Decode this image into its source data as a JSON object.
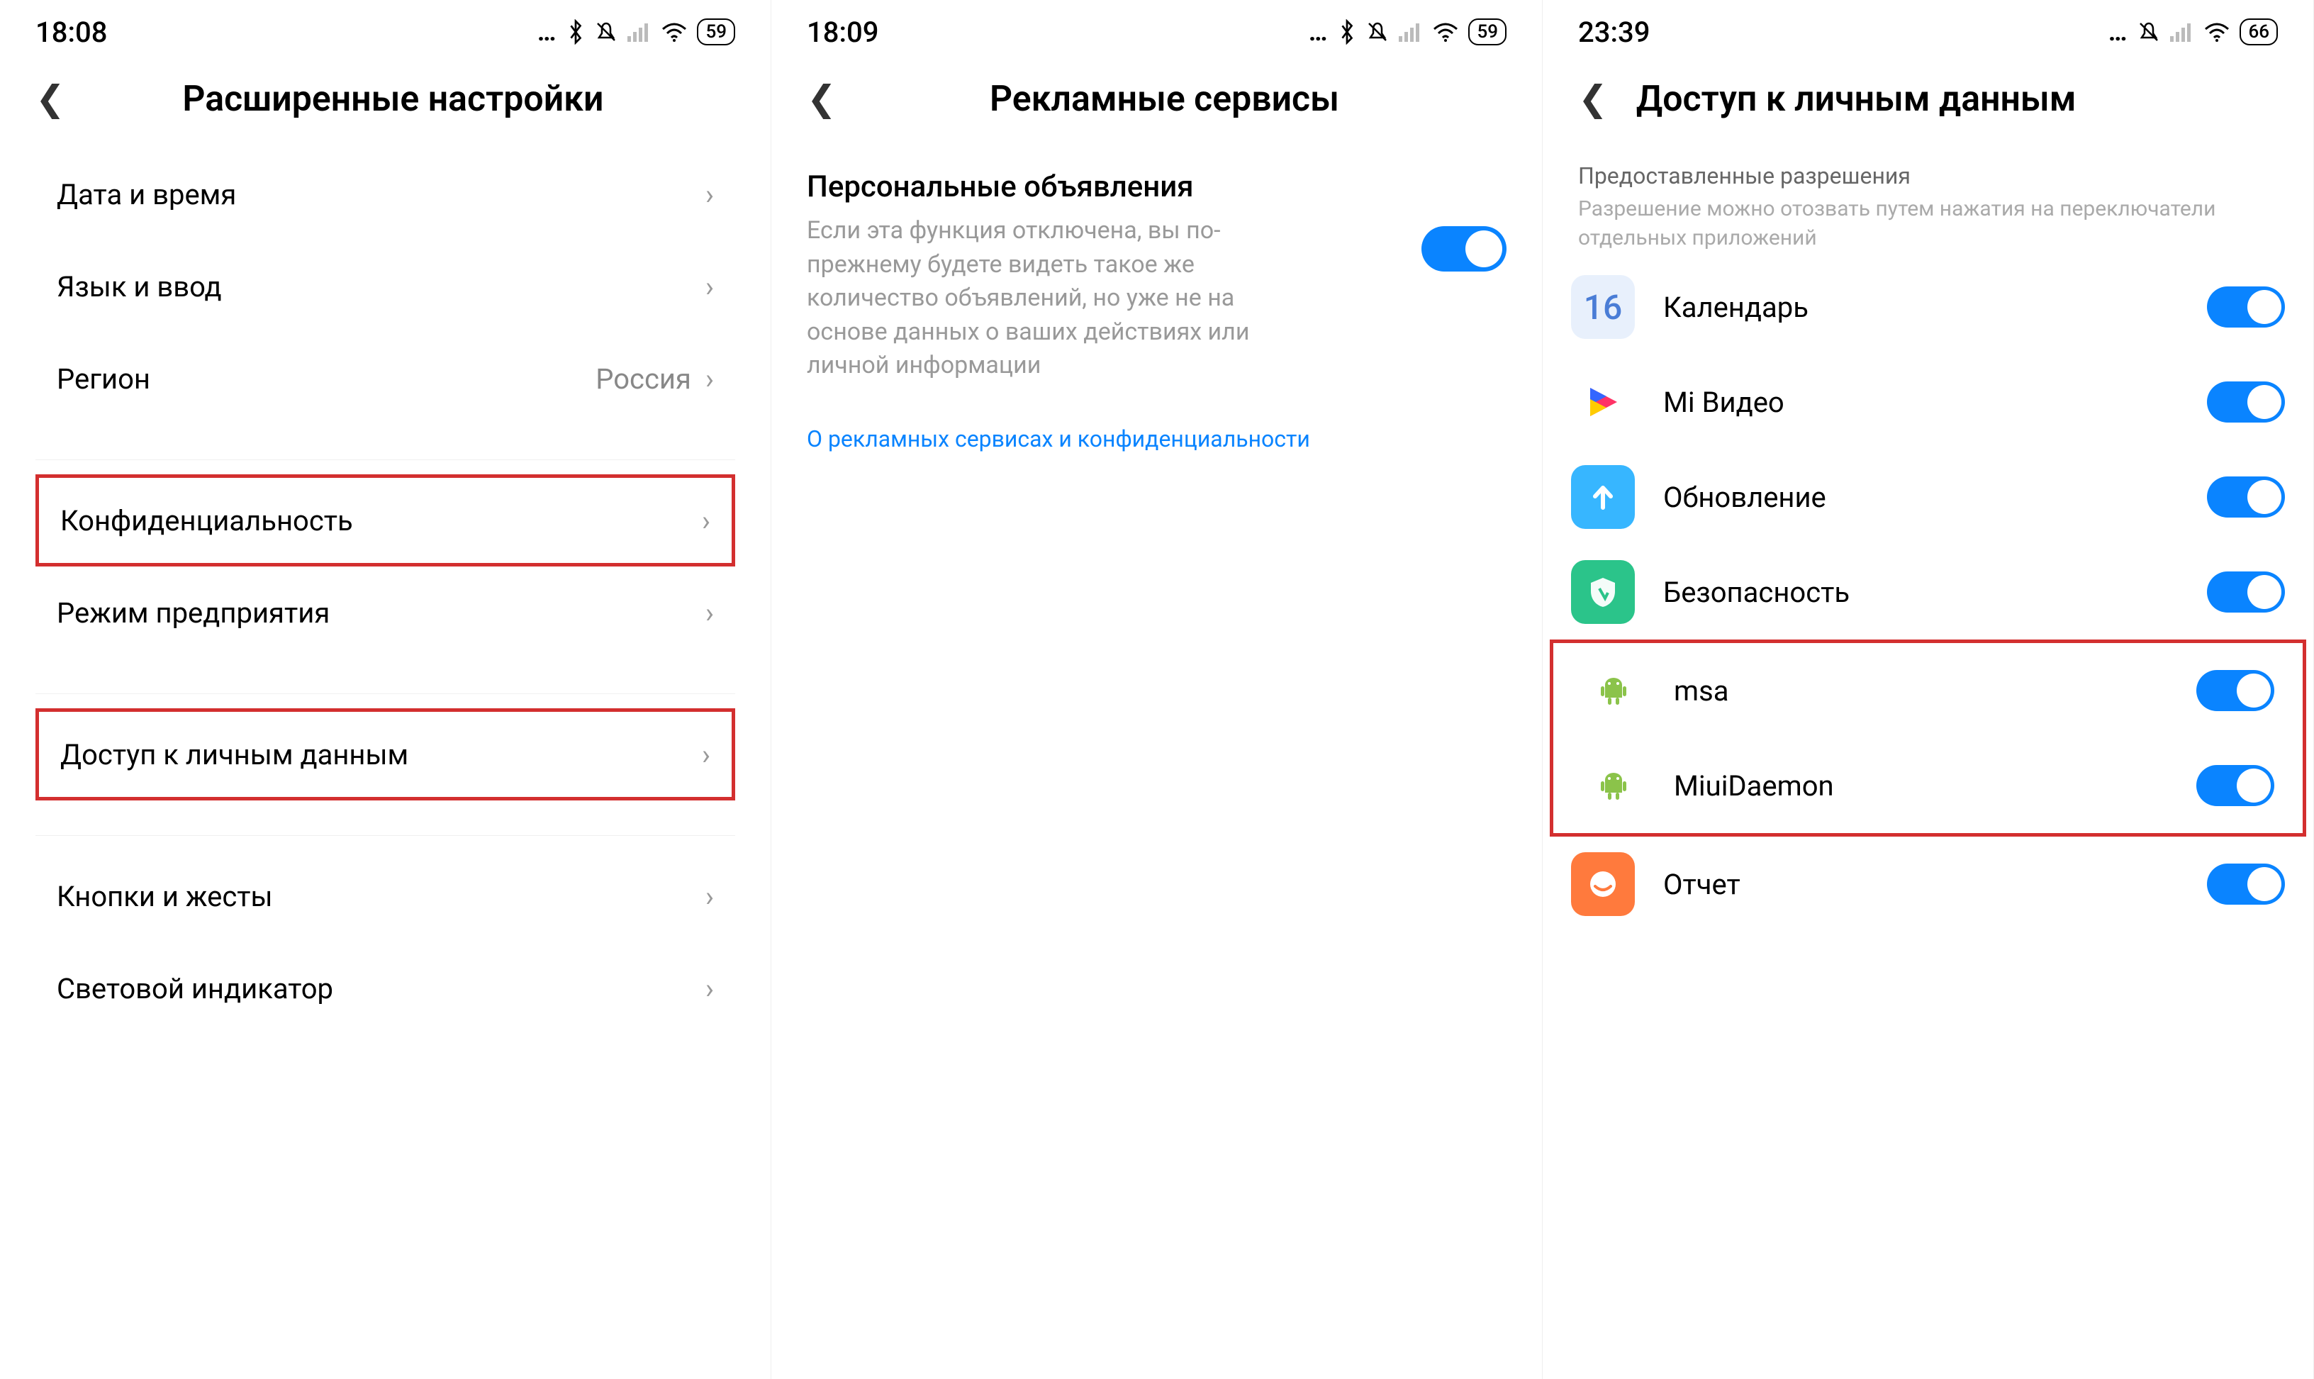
{
  "screen1": {
    "status": {
      "time": "18:08",
      "battery": "59"
    },
    "title": "Расширенные настройки",
    "items": [
      {
        "label": "Дата и время",
        "value": ""
      },
      {
        "label": "Язык и ввод",
        "value": ""
      },
      {
        "label": "Регион",
        "value": "Россия"
      }
    ],
    "group2": [
      {
        "label": "Конфиденциальность",
        "highlight": true
      },
      {
        "label": "Режим предприятия",
        "highlight": false
      }
    ],
    "group3": [
      {
        "label": "Доступ к личным данным",
        "highlight": true
      }
    ],
    "group4": [
      {
        "label": "Кнопки и жесты"
      },
      {
        "label": "Световой индикатор"
      }
    ]
  },
  "screen2": {
    "status": {
      "time": "18:09",
      "battery": "59"
    },
    "title": "Рекламные сервисы",
    "setting": {
      "title": "Персональные объявления",
      "desc": "Если эта функция отключена, вы по-прежнему будете видеть такое же количество объявлений, но уже не на основе данных о ваших действиях или личной информации"
    },
    "link": "О рекламных сервисах и конфиденциальности"
  },
  "screen3": {
    "status": {
      "time": "23:39",
      "battery": "66"
    },
    "title": "Доступ к личным данным",
    "section": {
      "title": "Предоставленные разрешения",
      "sub": "Разрешение можно отозвать путем нажатия на переключатели отдельных приложений"
    },
    "apps": [
      {
        "name": "Календарь",
        "icon": "calendar",
        "text": "16"
      },
      {
        "name": "Mi Видео",
        "icon": "mivideo"
      },
      {
        "name": "Обновление",
        "icon": "update"
      },
      {
        "name": "Безопасность",
        "icon": "security"
      },
      {
        "name": "msa",
        "icon": "android",
        "highlight": true
      },
      {
        "name": "MiuiDaemon",
        "icon": "android",
        "highlight": true
      },
      {
        "name": "Отчет",
        "icon": "report"
      }
    ]
  }
}
